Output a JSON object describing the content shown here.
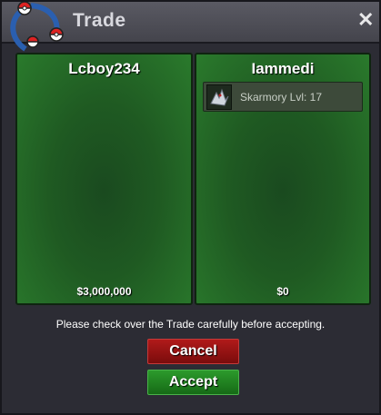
{
  "window": {
    "title": "Trade",
    "close_glyph": "✕"
  },
  "left_panel": {
    "player": "Lcboy234",
    "money": "$3,000,000"
  },
  "right_panel": {
    "player": "Iammedi",
    "money": "$0",
    "items": [
      {
        "label": "Skarmory  Lvl: 17",
        "icon": "skarmory-icon"
      }
    ]
  },
  "notice": "Please check over the Trade carefully before accepting.",
  "buttons": {
    "cancel": "Cancel",
    "accept": "Accept"
  },
  "colors": {
    "panel_green": "#1f5a22",
    "cancel_red": "#9a1414",
    "accept_green": "#238a23",
    "titlebar": "#4e4e57"
  }
}
